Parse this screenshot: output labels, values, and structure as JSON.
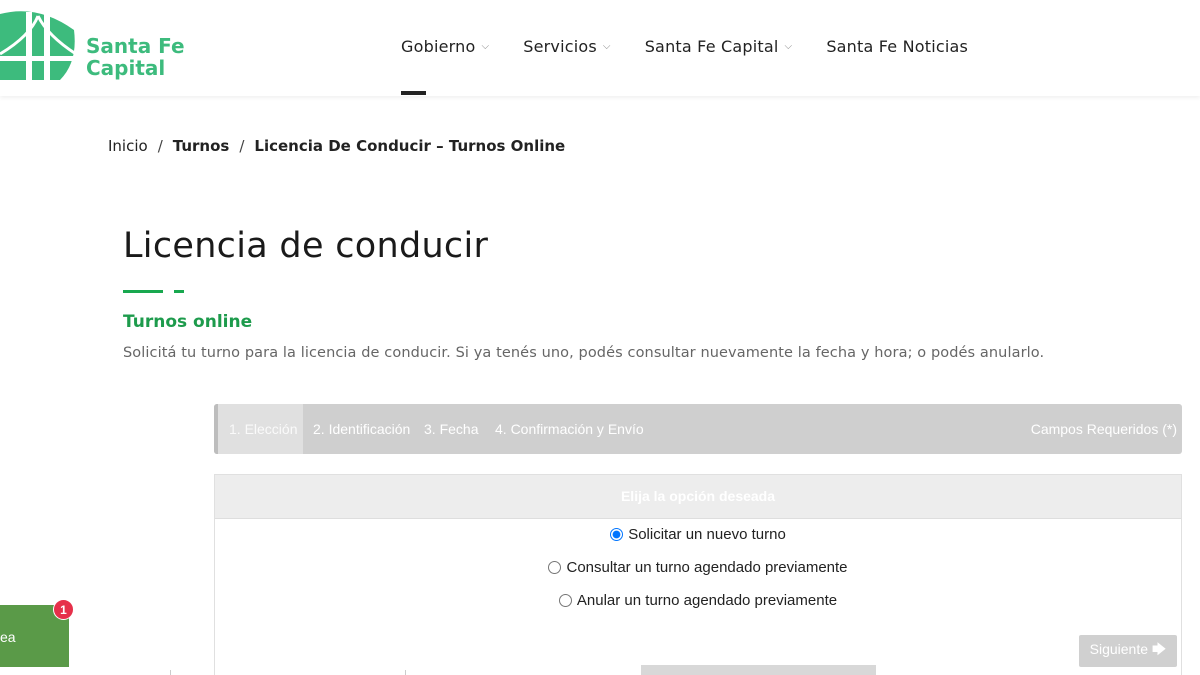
{
  "header": {
    "logo": {
      "line1": "Santa Fe",
      "line2": "Capital",
      "color": "#3dbb7d"
    },
    "nav": [
      {
        "label": "Gobierno",
        "has_dropdown": true
      },
      {
        "label": "Servicios",
        "has_dropdown": true
      },
      {
        "label": "Santa Fe Capital",
        "has_dropdown": true
      },
      {
        "label": "Santa Fe Noticias",
        "has_dropdown": false
      }
    ],
    "chevron": "⌵"
  },
  "breadcrumb": {
    "items": [
      "Inicio",
      "Turnos",
      "Licencia De Conducir – Turnos Online"
    ],
    "separator": "/"
  },
  "page": {
    "title": "Licencia de conducir",
    "subtitle": "Turnos online",
    "description": "Solicitá tu turno para la licencia de conducir. Si ya tenés uno, podés consultar nuevamente la fecha y hora; o podés anularlo.",
    "accent_color": "#18a84f"
  },
  "wizard": {
    "steps": [
      "1. Elección",
      "2. Identificación",
      "3. Fecha",
      "4. Confirmación y Envío"
    ],
    "active_step": 0,
    "required_note": "Campos Requeridos (*)"
  },
  "options_panel": {
    "heading": "Elija la opción deseada",
    "options": [
      {
        "label": "Solicitar un nuevo turno",
        "checked": true
      },
      {
        "label": "Consultar un turno agendado previamente",
        "checked": false
      },
      {
        "label": "Anular un turno agendado previamente",
        "checked": false
      }
    ],
    "next_label": "Siguiente",
    "next_icon": "🡆"
  },
  "chat_widget": {
    "label": "ea",
    "badge_count": "1",
    "color": "#5a9a48"
  }
}
